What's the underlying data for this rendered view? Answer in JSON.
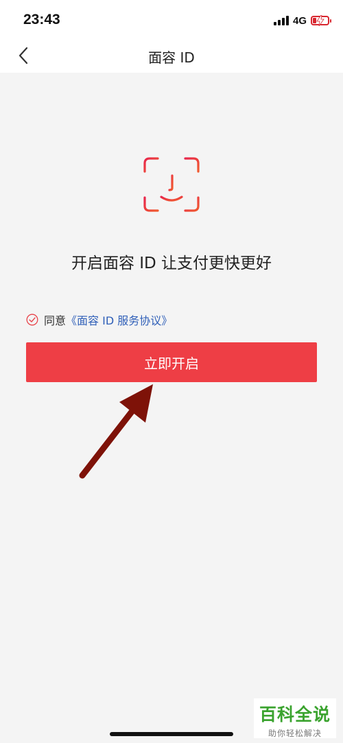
{
  "status_bar": {
    "time": "23:43",
    "network": "4G",
    "battery_level": 0.2,
    "battery_color": "#d8252e",
    "signal_icon": "signal-bars-icon",
    "battery_icon": "battery-charging-icon"
  },
  "nav": {
    "back_icon": "chevron-left-icon",
    "title": "面容 ID"
  },
  "main": {
    "face_icon": "face-id-icon",
    "headline": "开启面容 ID 让支付更快更好",
    "agreement": {
      "check_icon": "check-circle-icon",
      "prefix": "同意",
      "link_text": "《面容 ID 服务协议》",
      "link_color": "#2f5fb8"
    },
    "enable_button_label": "立即开启",
    "button_color": "#ee3e45"
  },
  "annotation": {
    "arrow_icon": "arrow-pointer-icon",
    "arrow_color": "#7e1208"
  },
  "watermark": {
    "title": "百科全说",
    "subtitle": "助你轻松解决"
  }
}
